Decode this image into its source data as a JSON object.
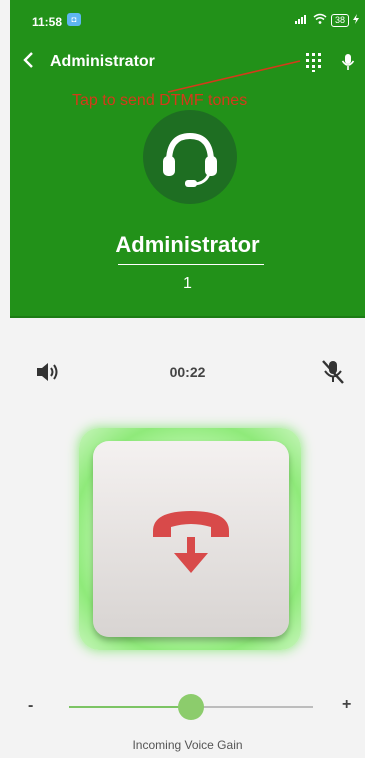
{
  "status_bar": {
    "time": "11:58",
    "app_badge": "◘",
    "battery": "38"
  },
  "toolbar": {
    "back_glyph": "‹",
    "title": "Administrator"
  },
  "annotation": {
    "text": "Tap to send DTMF tones"
  },
  "caller": {
    "name": "Administrator",
    "extension": "1"
  },
  "call": {
    "timer": "00:22"
  },
  "gain_slider": {
    "min_label": "-",
    "max_label": "+",
    "value_fraction": 0.5,
    "label": "Incoming Voice Gain"
  },
  "colors": {
    "primary_green": "#229119",
    "hint_red": "#d43a1a",
    "hangup_red": "#d84a4a"
  },
  "icons": [
    "back-arrow-icon",
    "dialpad-icon",
    "microphone-icon",
    "headset-icon",
    "speaker-icon",
    "mic-muted-icon",
    "hangup-phone-icon"
  ]
}
